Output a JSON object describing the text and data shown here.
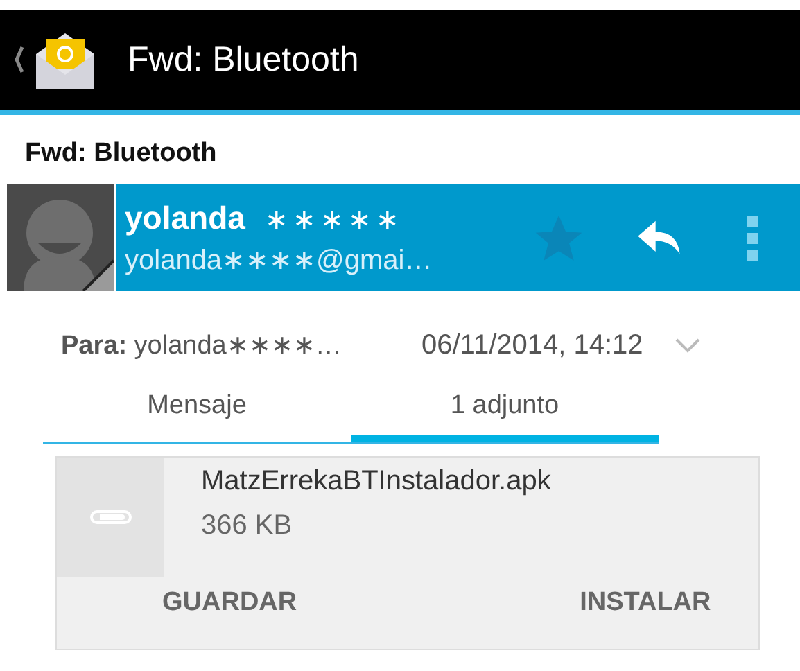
{
  "action_bar": {
    "title": "Fwd: Bluetooth"
  },
  "subject": "Fwd: Bluetooth",
  "sender": {
    "name": "yolanda",
    "name_mask": "∗∗∗∗∗",
    "email": "yolanda∗∗∗∗@gmai…",
    "starred": false
  },
  "recipient": {
    "label": "Para:",
    "value": "yolanda∗∗∗∗…",
    "date": "06/11/2014, 14:12"
  },
  "tabs": [
    {
      "label": "Mensaje",
      "selected": false
    },
    {
      "label": "1 adjunto",
      "selected": true
    }
  ],
  "attachment": {
    "name": "MatzErrekaBTInstalador.apk",
    "size": "366 KB",
    "actions": [
      "GUARDAR",
      "INSTALAR"
    ]
  }
}
